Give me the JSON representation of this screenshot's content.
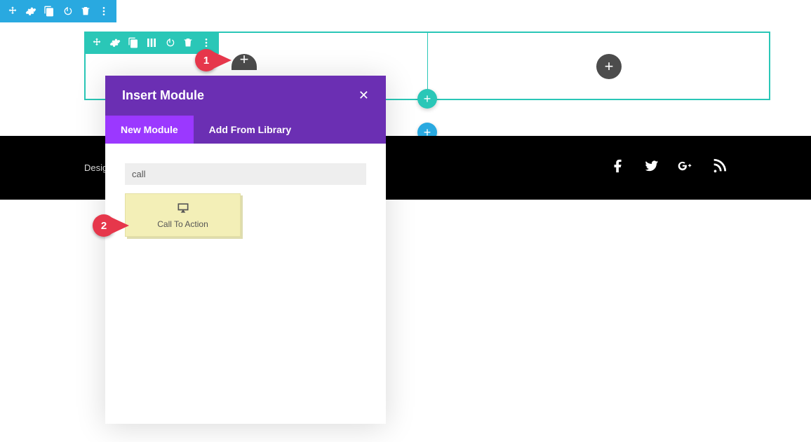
{
  "section_toolbar": {
    "icons": [
      "move",
      "settings",
      "clone",
      "toggle",
      "trash",
      "more"
    ]
  },
  "row_toolbar": {
    "icons": [
      "move",
      "settings",
      "clone",
      "columns",
      "toggle",
      "trash",
      "more"
    ]
  },
  "modal": {
    "title": "Insert Module",
    "tabs": {
      "new": "New Module",
      "library": "Add From Library"
    },
    "search_value": "call",
    "module_label": "Call To Action"
  },
  "footer": {
    "text": "Desig"
  },
  "annotations": {
    "one": "1",
    "two": "2"
  }
}
